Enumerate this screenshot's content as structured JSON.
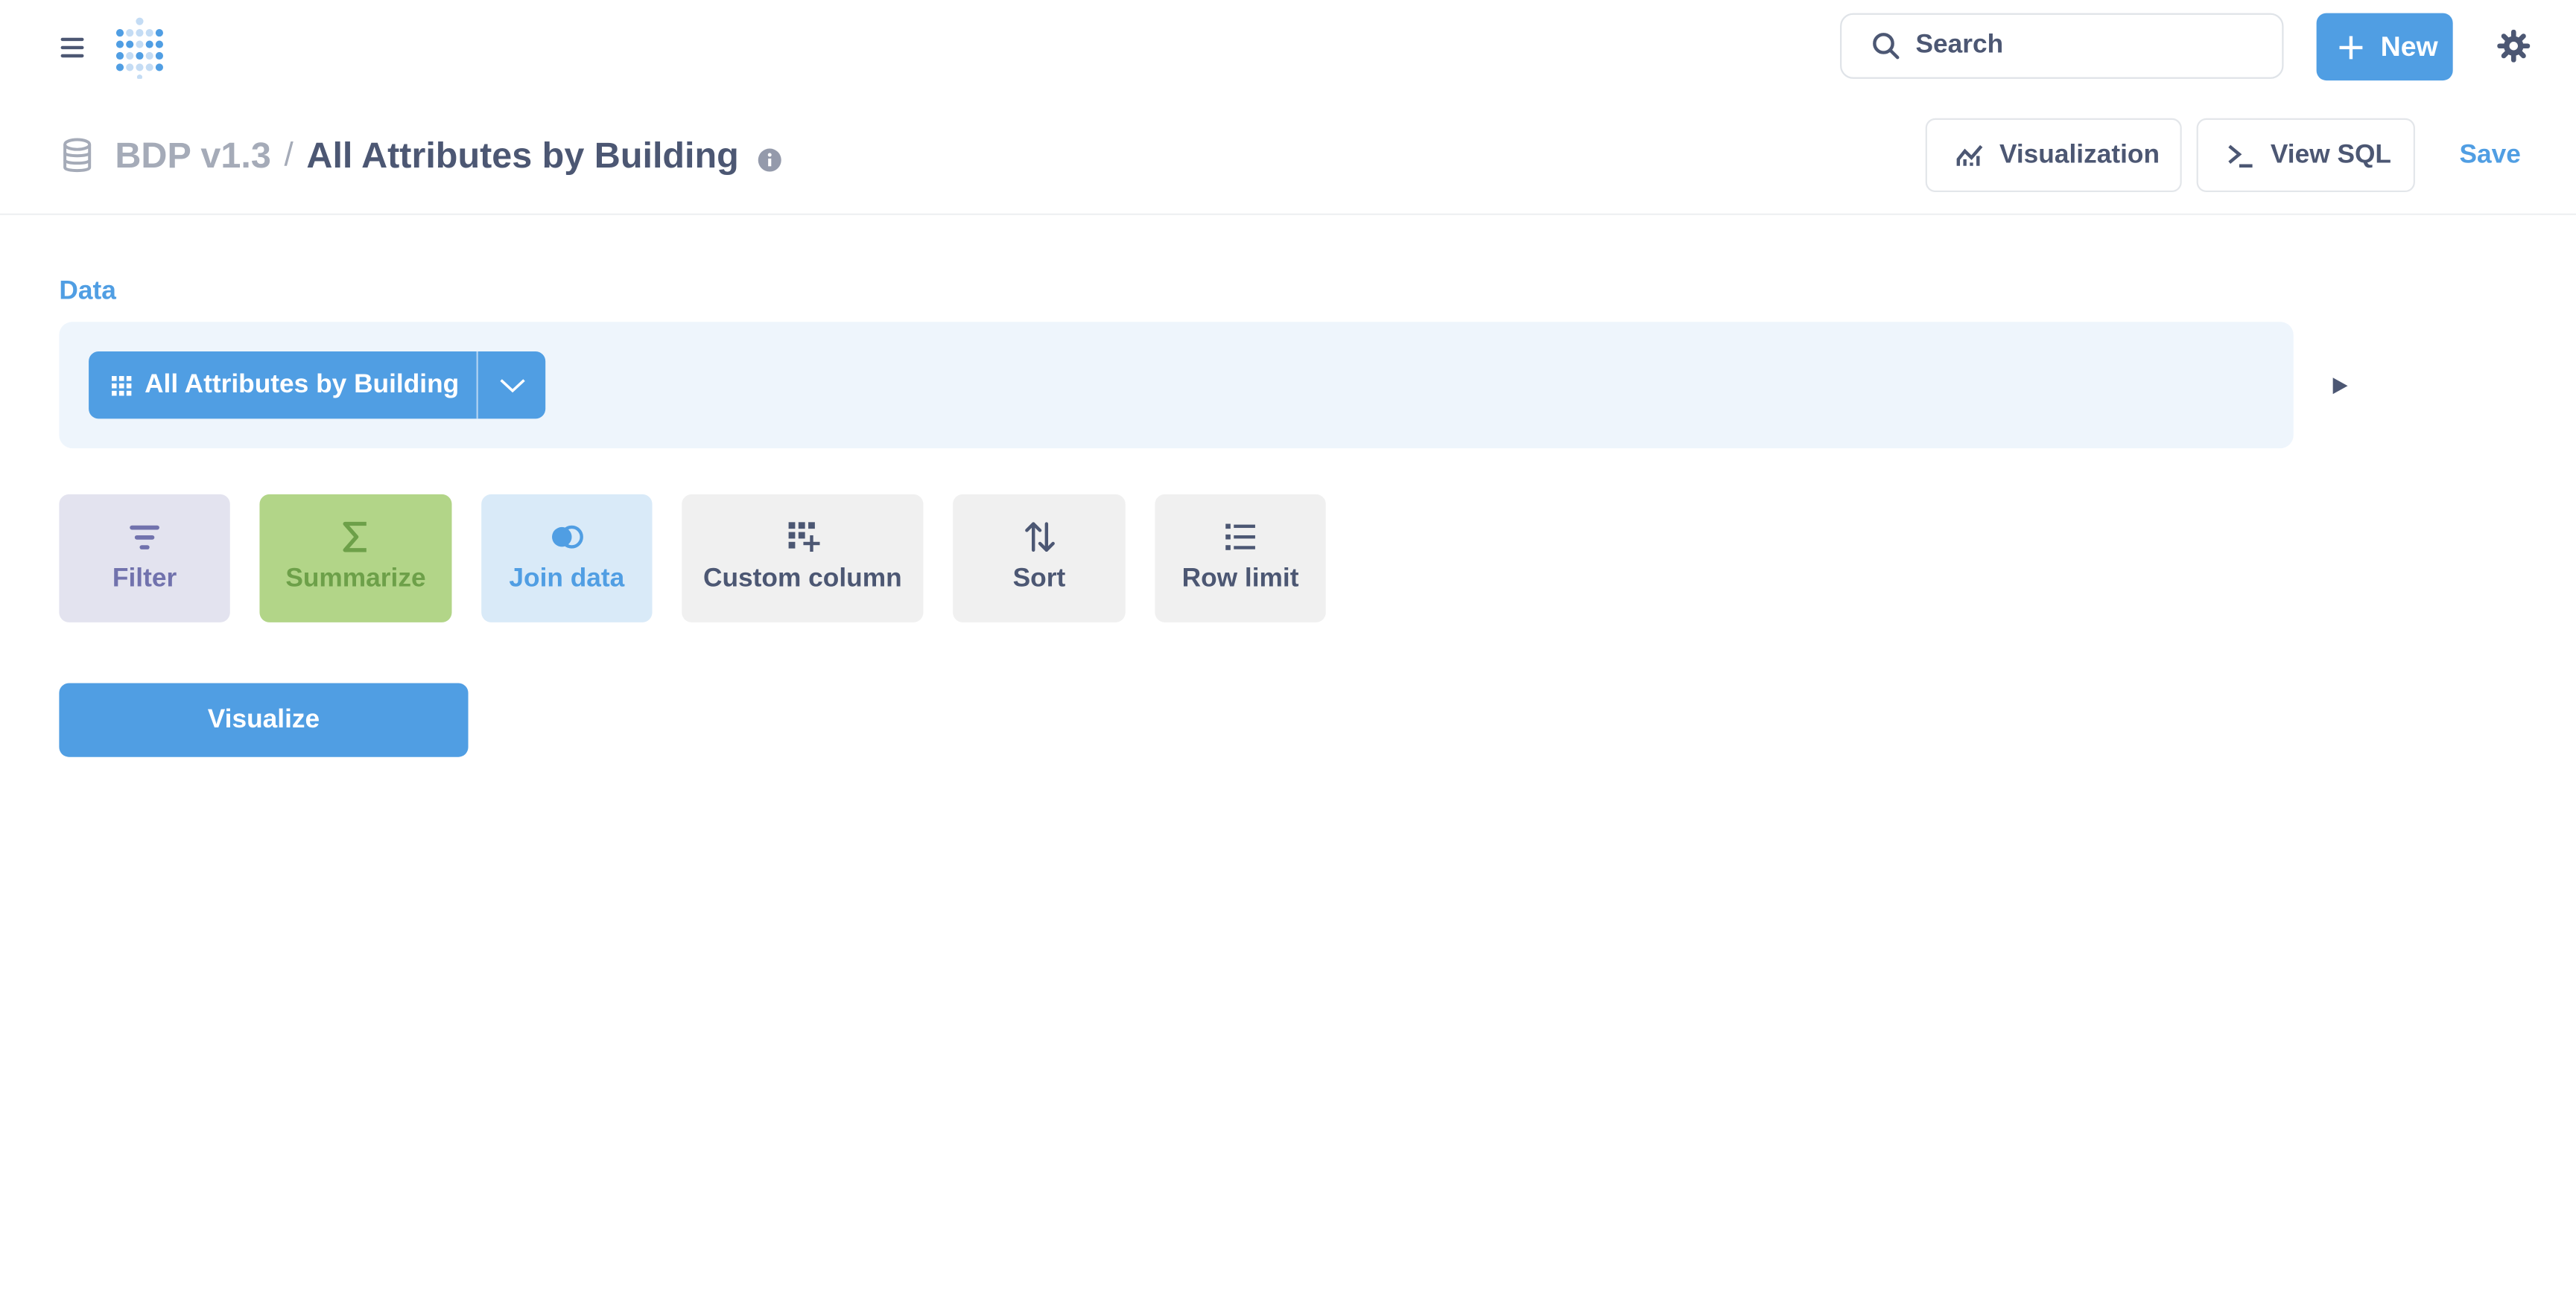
{
  "nav": {
    "search_placeholder": "Search",
    "new_label": "New"
  },
  "header": {
    "database": "BDP v1.3",
    "separator": "/",
    "question_title": "All Attributes by Building",
    "visualization_label": "Visualization",
    "view_sql_label": "View SQL",
    "save_label": "Save"
  },
  "notebook": {
    "data_label": "Data",
    "source_table": "All Attributes by Building",
    "actions": [
      {
        "label": "Filter",
        "icon": "filter-icon"
      },
      {
        "label": "Summarize",
        "icon": "sigma-icon"
      },
      {
        "label": "Join data",
        "icon": "join-icon"
      },
      {
        "label": "Custom column",
        "icon": "add-column-icon"
      },
      {
        "label": "Sort",
        "icon": "sort-icon"
      },
      {
        "label": "Row limit",
        "icon": "list-icon"
      }
    ],
    "visualize_label": "Visualize"
  },
  "colors": {
    "brand": "#509ee3",
    "text_dark": "#4c5773",
    "text_light": "#a5abb8",
    "filter": "#7172ad",
    "summarize": "#6da049",
    "summarize_bg": "#b2d588",
    "data_panel_bg": "#eef5fc"
  }
}
